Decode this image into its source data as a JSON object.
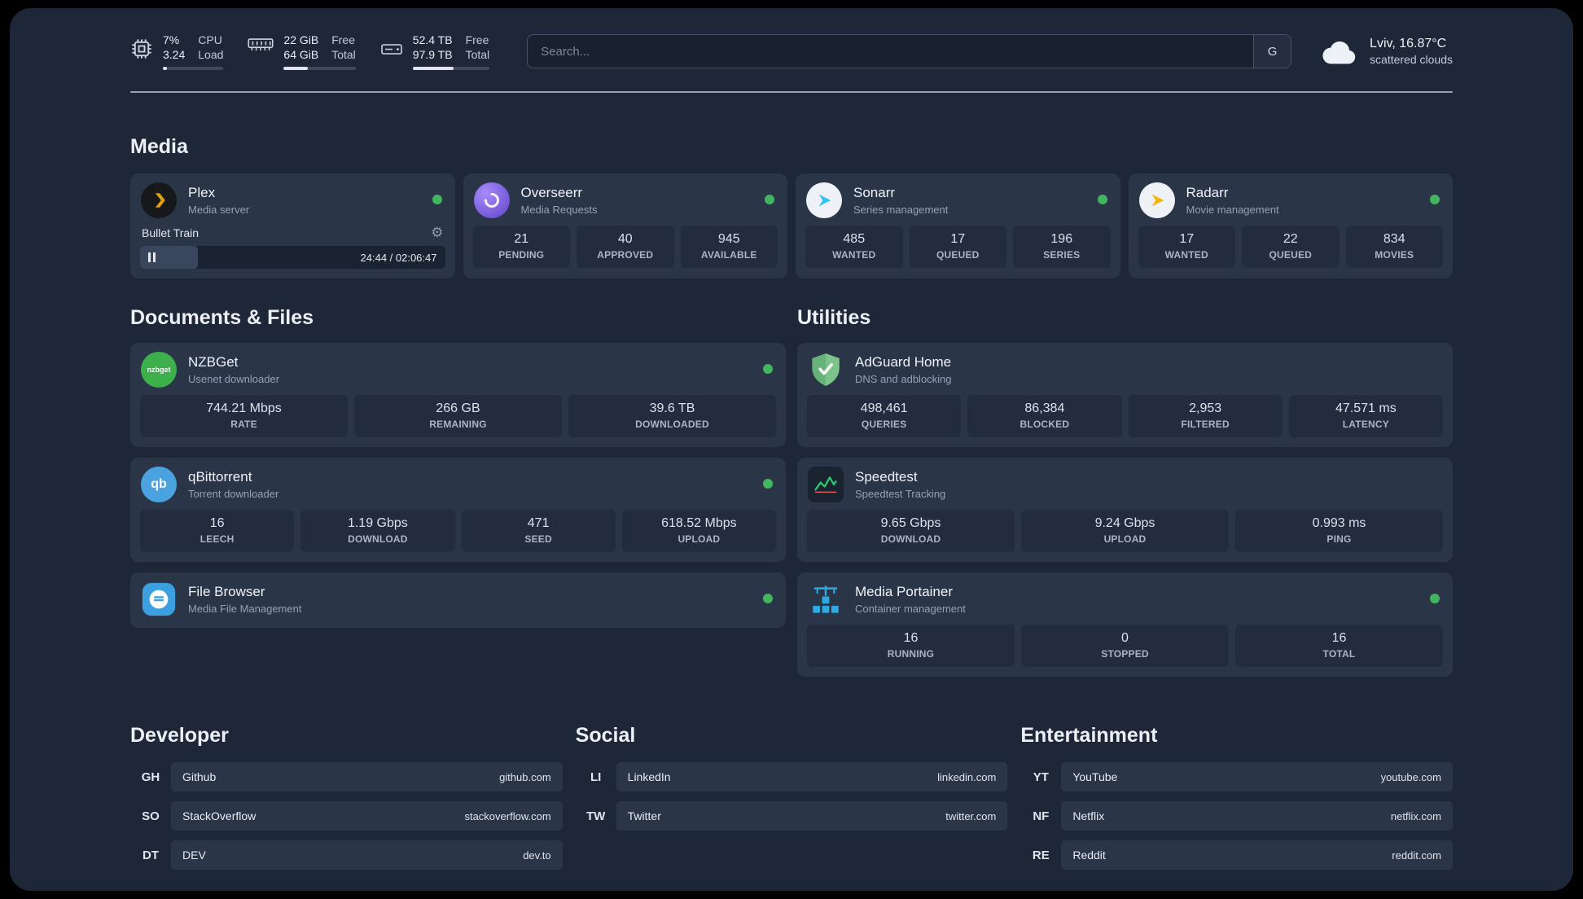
{
  "header": {
    "cpu": {
      "value1": "7%",
      "value2": "3.24",
      "label1": "CPU",
      "label2": "Load",
      "progress_percent": 7
    },
    "ram": {
      "value1": "22 GiB",
      "value2": "64 GiB",
      "label1": "Free",
      "label2": "Total",
      "progress_percent": 34
    },
    "disk": {
      "value1": "52.4 TB",
      "value2": "97.9 TB",
      "label1": "Free",
      "label2": "Total",
      "progress_percent": 53
    },
    "search": {
      "placeholder": "Search...",
      "button_label": "G"
    },
    "weather": {
      "location": "Lviv, 16.87°C",
      "condition": "scattered clouds"
    }
  },
  "sections": {
    "media": {
      "title": "Media"
    },
    "documents": {
      "title": "Documents & Files"
    },
    "utilities": {
      "title": "Utilities"
    },
    "developer": {
      "title": "Developer"
    },
    "social": {
      "title": "Social"
    },
    "entertainment": {
      "title": "Entertainment"
    }
  },
  "apps": {
    "plex": {
      "name": "Plex",
      "subtitle": "Media server",
      "now_playing": "Bullet Train",
      "time": "24:44 / 02:06:47",
      "progress_percent": 19
    },
    "overseerr": {
      "name": "Overseerr",
      "subtitle": "Media Requests",
      "stats": [
        {
          "value": "21",
          "label": "PENDING"
        },
        {
          "value": "40",
          "label": "APPROVED"
        },
        {
          "value": "945",
          "label": "AVAILABLE"
        }
      ]
    },
    "sonarr": {
      "name": "Sonarr",
      "subtitle": "Series management",
      "stats": [
        {
          "value": "485",
          "label": "WANTED"
        },
        {
          "value": "17",
          "label": "QUEUED"
        },
        {
          "value": "196",
          "label": "SERIES"
        }
      ]
    },
    "radarr": {
      "name": "Radarr",
      "subtitle": "Movie management",
      "stats": [
        {
          "value": "17",
          "label": "WANTED"
        },
        {
          "value": "22",
          "label": "QUEUED"
        },
        {
          "value": "834",
          "label": "MOVIES"
        }
      ]
    },
    "nzbget": {
      "name": "NZBGet",
      "subtitle": "Usenet downloader",
      "stats": [
        {
          "value": "744.21 Mbps",
          "label": "RATE"
        },
        {
          "value": "266 GB",
          "label": "REMAINING"
        },
        {
          "value": "39.6 TB",
          "label": "DOWNLOADED"
        }
      ]
    },
    "qbittorrent": {
      "name": "qBittorrent",
      "subtitle": "Torrent downloader",
      "stats": [
        {
          "value": "16",
          "label": "LEECH"
        },
        {
          "value": "1.19 Gbps",
          "label": "DOWNLOAD"
        },
        {
          "value": "471",
          "label": "SEED"
        },
        {
          "value": "618.52 Mbps",
          "label": "UPLOAD"
        }
      ]
    },
    "filebrowser": {
      "name": "File Browser",
      "subtitle": "Media File Management"
    },
    "adguard": {
      "name": "AdGuard Home",
      "subtitle": "DNS and adblocking",
      "stats": [
        {
          "value": "498,461",
          "label": "QUERIES"
        },
        {
          "value": "86,384",
          "label": "BLOCKED"
        },
        {
          "value": "2,953",
          "label": "FILTERED"
        },
        {
          "value": "47.571 ms",
          "label": "LATENCY"
        }
      ]
    },
    "speedtest": {
      "name": "Speedtest",
      "subtitle": "Speedtest Tracking",
      "stats": [
        {
          "value": "9.65 Gbps",
          "label": "DOWNLOAD"
        },
        {
          "value": "9.24 Gbps",
          "label": "UPLOAD"
        },
        {
          "value": "0.993 ms",
          "label": "PING"
        }
      ]
    },
    "portainer": {
      "name": "Media Portainer",
      "subtitle": "Container management",
      "stats": [
        {
          "value": "16",
          "label": "RUNNING"
        },
        {
          "value": "0",
          "label": "STOPPED"
        },
        {
          "value": "16",
          "label": "TOTAL"
        }
      ]
    }
  },
  "icon_labels": {
    "nzbget": "nzbget",
    "qbittorrent": "qb"
  },
  "bookmarks": {
    "developer": [
      {
        "abbr": "GH",
        "name": "Github",
        "url": "github.com"
      },
      {
        "abbr": "SO",
        "name": "StackOverflow",
        "url": "stackoverflow.com"
      },
      {
        "abbr": "DT",
        "name": "DEV",
        "url": "dev.to"
      }
    ],
    "social": [
      {
        "abbr": "LI",
        "name": "LinkedIn",
        "url": "linkedin.com"
      },
      {
        "abbr": "TW",
        "name": "Twitter",
        "url": "twitter.com"
      }
    ],
    "entertainment": [
      {
        "abbr": "YT",
        "name": "YouTube",
        "url": "youtube.com"
      },
      {
        "abbr": "NF",
        "name": "Netflix",
        "url": "netflix.com"
      },
      {
        "abbr": "RE",
        "name": "Reddit",
        "url": "reddit.com"
      }
    ]
  },
  "colors": {
    "status_online": "#43b55f",
    "plex_brand": "#e5a00d",
    "overseerr_brand": "#6d4ddb",
    "sonarr_brand": "#35c5f4",
    "radarr_brand": "#f7b500",
    "nzbget_brand": "#3db04b",
    "qbittorrent_brand": "#4aa3df",
    "filebrowser_brand": "#3c9fe0",
    "adguard_brand": "#67b279",
    "speedtest_brand": "#2ecc71",
    "portainer_brand": "#2daae2"
  }
}
